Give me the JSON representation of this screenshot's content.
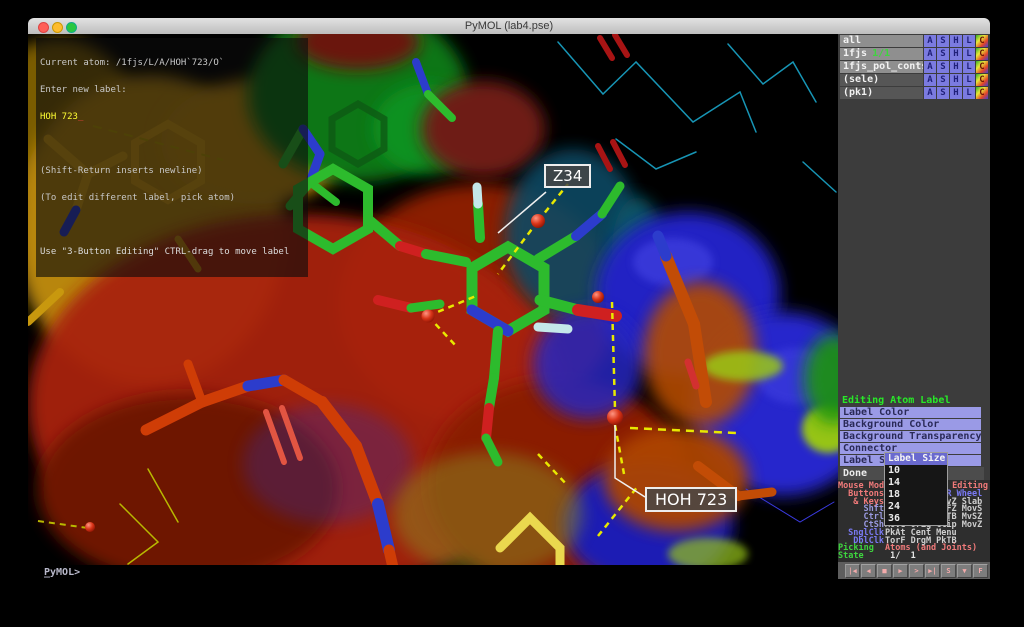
{
  "window": {
    "title": "PyMOL (lab4.pse)"
  },
  "overlay": {
    "current_atom": "Current atom: /1fjs/L/A/HOH`723/O`",
    "enter_label": "Enter new label:",
    "label_value": "HOH 723",
    "cursor": "_",
    "hint1": "(Shift-Return inserts newline)",
    "hint2": "(To edit different label, pick atom)",
    "hint3": "Use \"3-Button Editing\" CTRL-drag to move label"
  },
  "scene": {
    "labels": {
      "residue": "Z34",
      "water": "HOH 723"
    }
  },
  "command_line": {
    "prompt": "PyMOL>",
    "cursor": "_"
  },
  "object_panel": {
    "buttons": [
      "A",
      "S",
      "H",
      "L",
      "C"
    ],
    "rows": [
      {
        "name": "all",
        "state": ""
      },
      {
        "name": "1fjs",
        "state": "1/1"
      },
      {
        "name": "1fjs_pol_conts",
        "state": ""
      },
      {
        "name": "(sele)",
        "state": ""
      },
      {
        "name": "(pk1)",
        "state": ""
      }
    ]
  },
  "menu": {
    "header": "Editing Atom Label",
    "items": [
      "Label Color",
      "Background Color",
      "Background Transparency",
      "Connector",
      "Label Size"
    ],
    "done": "Done"
  },
  "dropdown": {
    "title": "Label Size",
    "items": [
      "10",
      "14",
      "18",
      "24",
      "36"
    ]
  },
  "mouse_panel": {
    "rows": [
      {
        "label": "Mouse Mode",
        "value": "3-Button Editing"
      },
      {
        "label": "Buttons",
        "value": "  L    M    R Wheel"
      },
      {
        "label": "& Keys",
        "value": "Rota Move MovZ Slab"
      },
      {
        "label": "Shft",
        "value": "RotF MovF MvFZ MovS"
      },
      {
        "label": "Ctrl",
        "value": "TorF PkAt PkTB MvSZ"
      },
      {
        "label": "CtSh",
        "value": "Move Orig Clip MovZ"
      },
      {
        "label": "SnglClk",
        "value": "PkAt Cent Menu"
      },
      {
        "label": "DblClk",
        "value": "TorF DrgM PkTB"
      },
      {
        "label": "Picking",
        "value": "Atoms (and Joints)"
      },
      {
        "label": "State",
        "value": " 1/  1"
      }
    ]
  },
  "vcr": {
    "buttons": [
      "|◀",
      "◀",
      "■",
      "▶",
      ">",
      "▶|",
      "S",
      "▼",
      "F"
    ]
  },
  "colors": {
    "menu_item_bg": "#9a9ae6",
    "menu_header_green": "#28e828",
    "panel_button_bg": "#7b7be0",
    "object_state_green": "#3fd43f",
    "label_input_yellow": "#ffff33",
    "cursor_red": "#ff4040",
    "hbond_yellow": "#e8e800",
    "salmon": "#f07a7a",
    "lavender": "#9a9ae0",
    "blue_label": "#7a7af5",
    "green_label": "#3ed43e",
    "vcr_glyph_pink": "#f2aaaa"
  }
}
